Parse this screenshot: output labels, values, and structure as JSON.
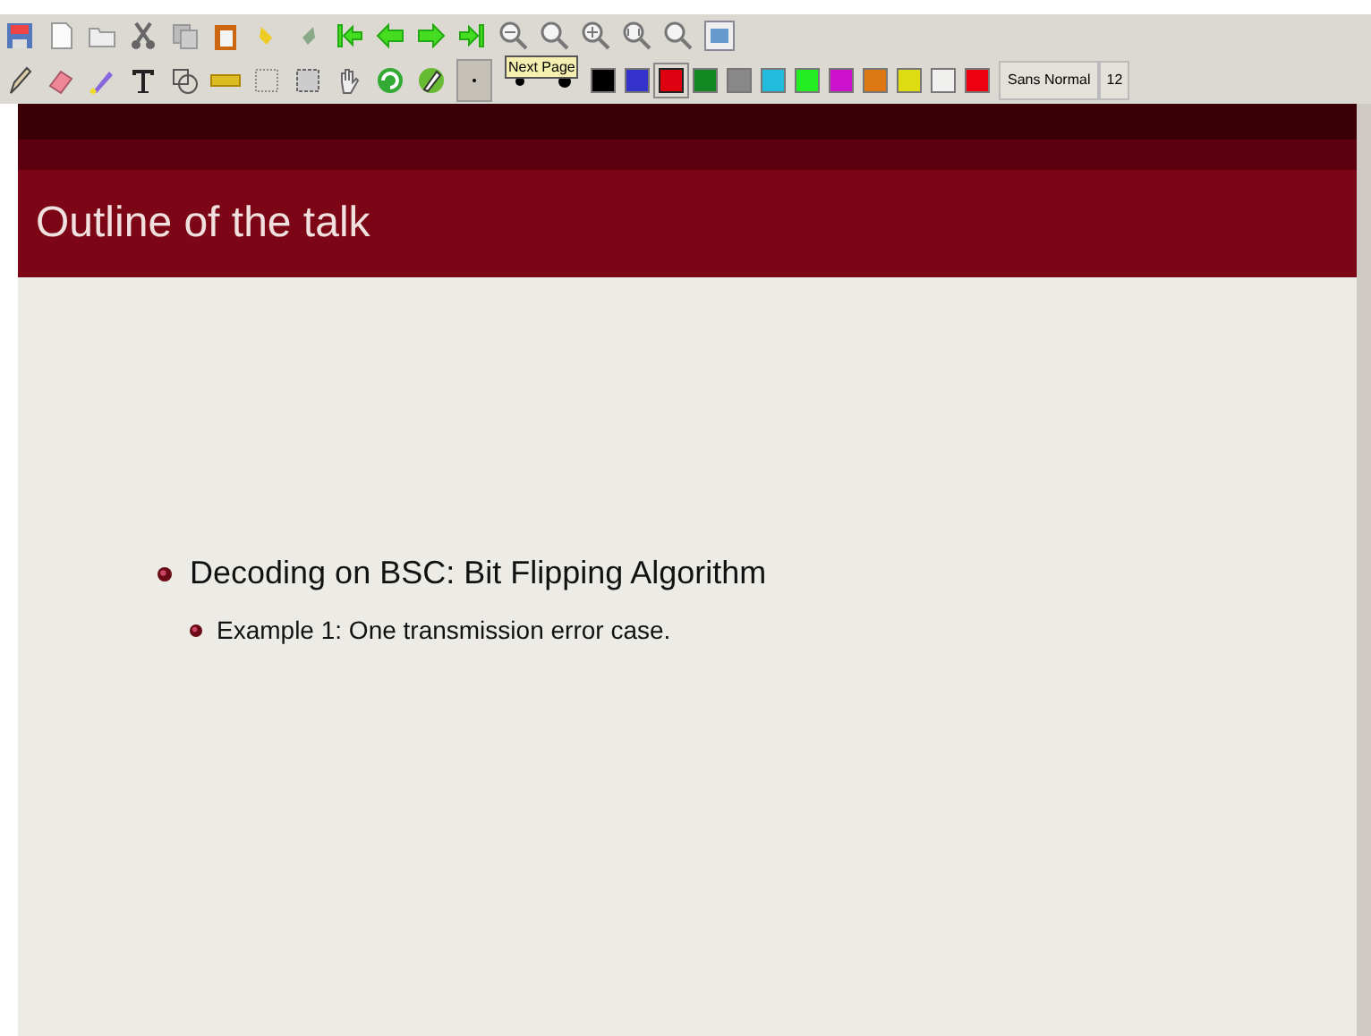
{
  "toolbar": {
    "tooltip": "Next Page",
    "pen_sizes": [
      {
        "selected": true
      },
      {
        "selected": false
      },
      {
        "selected": false
      }
    ],
    "colors": [
      {
        "color": "#000000",
        "selected": false
      },
      {
        "color": "#3333cc",
        "selected": false
      },
      {
        "color": "#dd0011",
        "selected": true
      },
      {
        "color": "#118822",
        "selected": false
      },
      {
        "color": "#888888",
        "selected": false
      },
      {
        "color": "#22bbdd",
        "selected": false
      },
      {
        "color": "#22ee22",
        "selected": false
      },
      {
        "color": "#cc11cc",
        "selected": false
      },
      {
        "color": "#dd7711",
        "selected": false
      },
      {
        "color": "#dddd11",
        "selected": false
      },
      {
        "color": "#f0f0ee",
        "selected": false
      },
      {
        "color": "#ee0011",
        "selected": false
      }
    ],
    "font_button": "Sans Normal",
    "font_size": "12"
  },
  "slide": {
    "title": "Outline of the talk",
    "items": [
      {
        "text": "Decoding on BSC: Bit Flipping Algorithm",
        "children": [
          {
            "text": "Example 1: One transmission error case."
          }
        ]
      }
    ]
  }
}
